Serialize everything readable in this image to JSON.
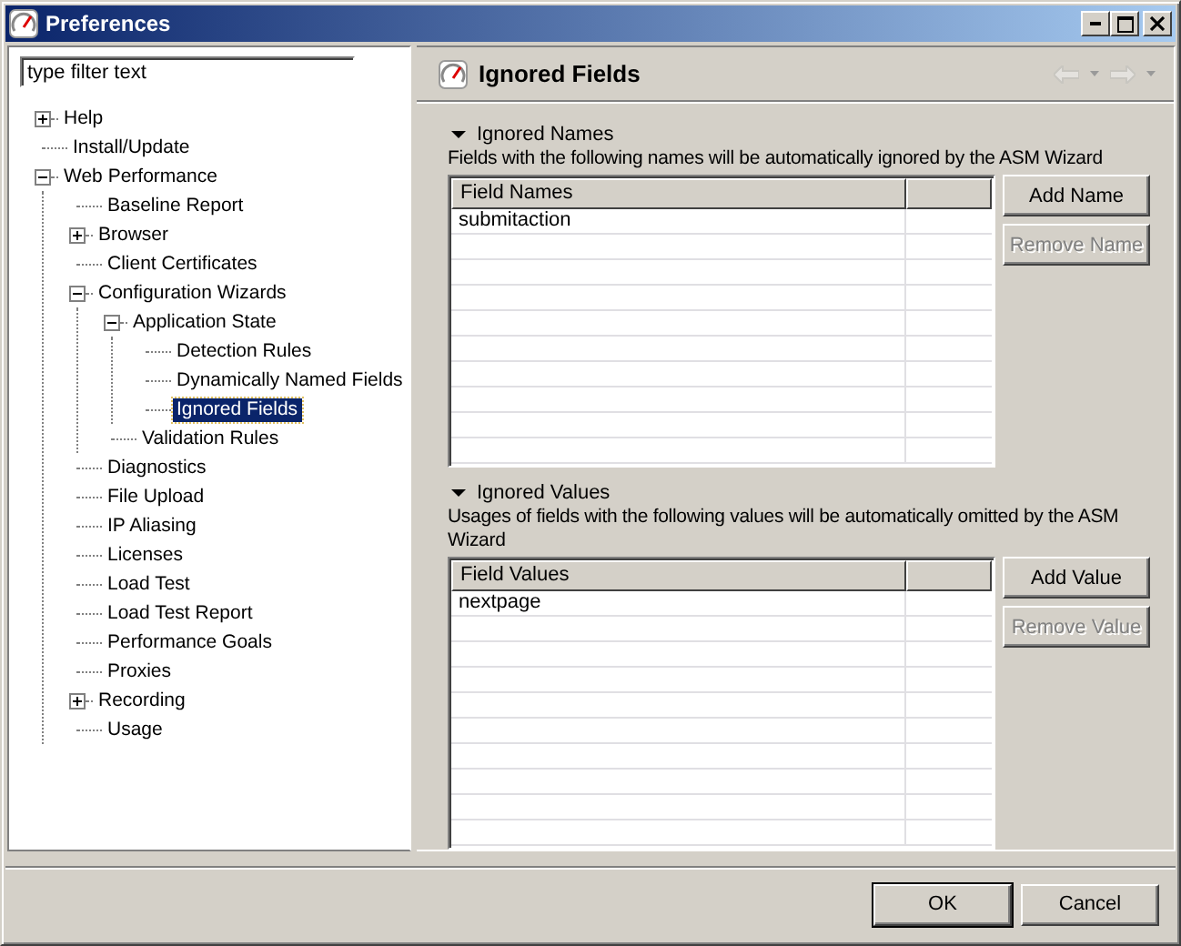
{
  "window": {
    "title": "Preferences"
  },
  "filter": {
    "value": "type filter text"
  },
  "tree": [
    {
      "label": "Help",
      "expanded": false,
      "selected": false
    },
    {
      "label": "Install/Update",
      "selected": false
    },
    {
      "label": "Web Performance",
      "expanded": true,
      "selected": false,
      "children": [
        {
          "label": "Baseline Report",
          "selected": false
        },
        {
          "label": "Browser",
          "expanded": false,
          "selected": false
        },
        {
          "label": "Client Certificates",
          "selected": false
        },
        {
          "label": "Configuration Wizards",
          "expanded": true,
          "selected": false,
          "children": [
            {
              "label": "Application State",
              "expanded": true,
              "selected": false,
              "children": [
                {
                  "label": "Detection Rules",
                  "selected": false
                },
                {
                  "label": "Dynamically Named Fields",
                  "selected": false
                },
                {
                  "label": "Ignored Fields",
                  "selected": true
                }
              ]
            },
            {
              "label": "Validation Rules",
              "selected": false
            }
          ]
        },
        {
          "label": "Diagnostics",
          "selected": false
        },
        {
          "label": "File Upload",
          "selected": false
        },
        {
          "label": "IP Aliasing",
          "selected": false
        },
        {
          "label": "Licenses",
          "selected": false
        },
        {
          "label": "Load Test",
          "selected": false
        },
        {
          "label": "Load Test Report",
          "selected": false
        },
        {
          "label": "Performance Goals",
          "selected": false
        },
        {
          "label": "Proxies",
          "selected": false
        },
        {
          "label": "Recording",
          "expanded": false,
          "selected": false
        },
        {
          "label": "Usage",
          "selected": false
        }
      ]
    }
  ],
  "page": {
    "title": "Ignored Fields"
  },
  "sections": [
    {
      "title": "Ignored Names",
      "expanded": true,
      "description": "Fields with the following names will be automatically ignored by the ASM Wizard",
      "column": "Field Names",
      "rows": [
        "submitaction"
      ],
      "buttons": [
        {
          "label": "Add Name",
          "disabled": false
        },
        {
          "label": "Remove Name",
          "disabled": true
        }
      ]
    },
    {
      "title": "Ignored Values",
      "expanded": true,
      "description": "Usages of fields with the following values will be automatically omitted by the ASM Wizard",
      "column": "Field Values",
      "rows": [
        "nextpage"
      ],
      "buttons": [
        {
          "label": "Add Value",
          "disabled": false
        },
        {
          "label": "Remove Value",
          "disabled": true
        }
      ]
    }
  ],
  "buttons": [
    {
      "label": "OK",
      "default": true
    },
    {
      "label": "Cancel",
      "default": false
    }
  ]
}
